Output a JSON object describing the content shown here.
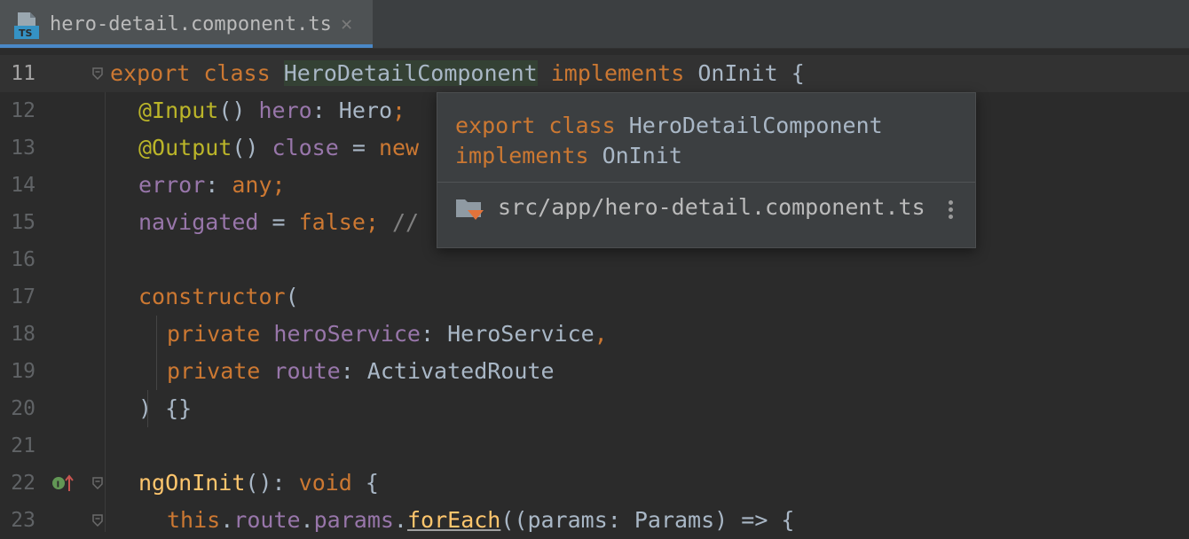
{
  "tab": {
    "file_icon": "typescript-file-icon",
    "file_icon_label": "TS",
    "title": "hero-detail.component.ts",
    "close_glyph": "✕"
  },
  "editor": {
    "line_numbers": [
      "11",
      "12",
      "13",
      "14",
      "15",
      "16",
      "17",
      "18",
      "19",
      "20",
      "21",
      "22",
      "23"
    ],
    "lines": {
      "l11": [
        "export",
        " ",
        "class",
        " ",
        "HeroDetailComponent",
        " ",
        "implements",
        " ",
        "OnInit",
        " {"
      ],
      "l12": [
        "@Input",
        "() ",
        "hero",
        ": Hero",
        ";"
      ],
      "l13": [
        "@Output",
        "() ",
        "close",
        " = ",
        "new"
      ],
      "l14": [
        "error",
        ": ",
        "any",
        ";"
      ],
      "l15": [
        "navigated",
        " = ",
        "false",
        ";",
        " //"
      ],
      "l17": [
        "constructor",
        "("
      ],
      "l18": [
        "private",
        " ",
        "heroService",
        ": HeroService",
        ","
      ],
      "l19": [
        "private",
        " ",
        "route",
        ": ActivatedRoute"
      ],
      "l20": [
        ") {}"
      ],
      "l22": [
        "ngOnInit",
        "(): ",
        "void",
        " {"
      ],
      "l23": [
        "this",
        ".",
        "route",
        ".",
        "params",
        ".",
        "forEach",
        "((params: Params) => {"
      ]
    },
    "gutter_badge_icon": "implements-method-icon"
  },
  "popup": {
    "signature_line1": [
      "export",
      " ",
      "class",
      " HeroDetailComponent"
    ],
    "signature_line2": [
      "implements",
      " OnInit"
    ],
    "location_icon": "folder-icon",
    "location": "src/app/hero-detail.component.ts",
    "more_icon": "more-vertical-icon"
  },
  "colors": {
    "background": "#2b2b2b",
    "keyword": "#cc7832",
    "annotation": "#bbb529",
    "field": "#9876aa",
    "function": "#ffc66d",
    "text": "#a9b7c6",
    "tab_accent": "#4a88c7"
  }
}
